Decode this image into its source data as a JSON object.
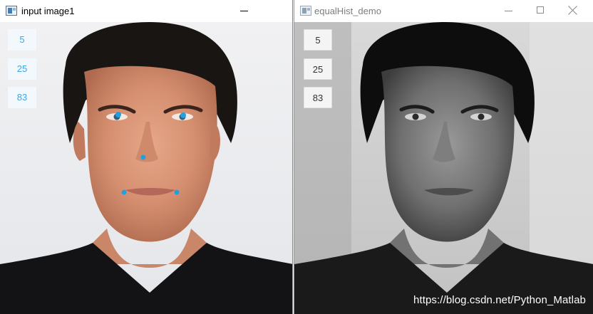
{
  "windows": [
    {
      "title": "input image1",
      "values": [
        "5",
        "25",
        "83"
      ],
      "landmark_color": "#21a0e0",
      "icons": {
        "app": "window-app-icon",
        "minimize": "minimize-icon",
        "maximize": "maximize-icon",
        "close": "close-icon"
      }
    },
    {
      "title": "equalHist_demo",
      "values": [
        "5",
        "25",
        "83"
      ],
      "icons": {
        "app": "window-app-icon",
        "minimize": "minimize-icon",
        "maximize": "maximize-icon",
        "close": "close-icon"
      }
    }
  ],
  "watermark": "https://blog.csdn.net/Python_Matlab"
}
